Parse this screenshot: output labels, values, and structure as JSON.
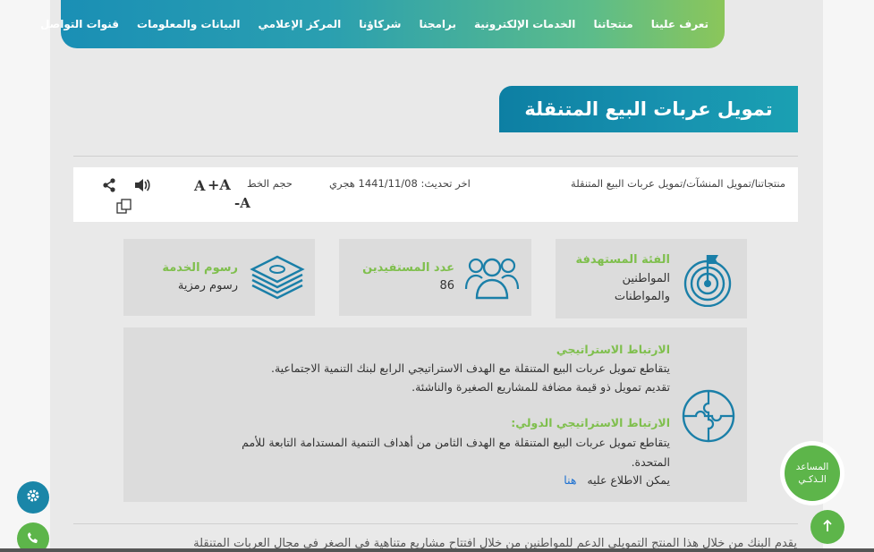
{
  "nav": {
    "items": [
      "تعرف علينا",
      "منتجاتنا",
      "الخدمات الإلكترونية",
      "برامجنا",
      "شركاؤنا",
      "المركز الإعلامي",
      "البيانات والمعلومات",
      "قنوات التواصل"
    ]
  },
  "page_title": "تمويل عربات البيع المتنقلة",
  "breadcrumb": {
    "items": [
      "منتجاتنا",
      "تمويل المنشآت",
      "تمويل عربات البيع المتنقلة"
    ],
    "sep": "/"
  },
  "updated": "اخر تحديث: 1441/11/08 هجري",
  "font_size": {
    "label": "حجم الخط",
    "increase": "A+",
    "normal": "A",
    "decrease": "A-"
  },
  "cards": {
    "target": {
      "title": "الفئة المستهدفة",
      "value_line1": "المواطنين",
      "value_line2": "والمواطنات"
    },
    "beneficiaries": {
      "title": "عدد المستفيدين",
      "value": "86"
    },
    "fees": {
      "title": "رسوم الخدمة",
      "value": "رسوم رمزية"
    }
  },
  "strategic": {
    "heading": "الارتباط الاستراتيجي",
    "line1": "يتقاطع تمويل عربات البيع المتنقلة مع الهدف الاستراتيجي الرابع لبنك التنمية الاجتماعية.",
    "line2": "تقديم تمويل ذو قيمة مضافة للمشاريع الصغيرة والناشئة.",
    "intl_heading": "الارتباط الاستراتيجي الدولي:",
    "intl_line1": "يتقاطع تمويل عربات البيع المتنقلة مع الهدف الثامن من أهداف التنمية المستدامة التابعة للأمم",
    "intl_line2": "المتحدة.",
    "more_text": "يمكن الاطلاع عليه",
    "more_link": "هنا"
  },
  "bottom_text": "يقدم البنك من خلال هذا المنتج التمويلي الدعم للمواطنين من خلال افتتاح مشاريع متناهية في الصغر في مجال العربات المتنقلة",
  "assistant": {
    "line1": "المساعد",
    "line2": "الـذكـي"
  },
  "colors": {
    "accent_green": "#7fbf4d",
    "accent_blue": "#0d7fa3",
    "card_bg": "#dcdcdc"
  },
  "icons": [
    "share-icon",
    "sound-icon",
    "copy-icon",
    "target-icon",
    "people-icon",
    "money-icon",
    "puzzle-icon",
    "settings-icon",
    "phone-icon",
    "arrow-up-icon"
  ]
}
